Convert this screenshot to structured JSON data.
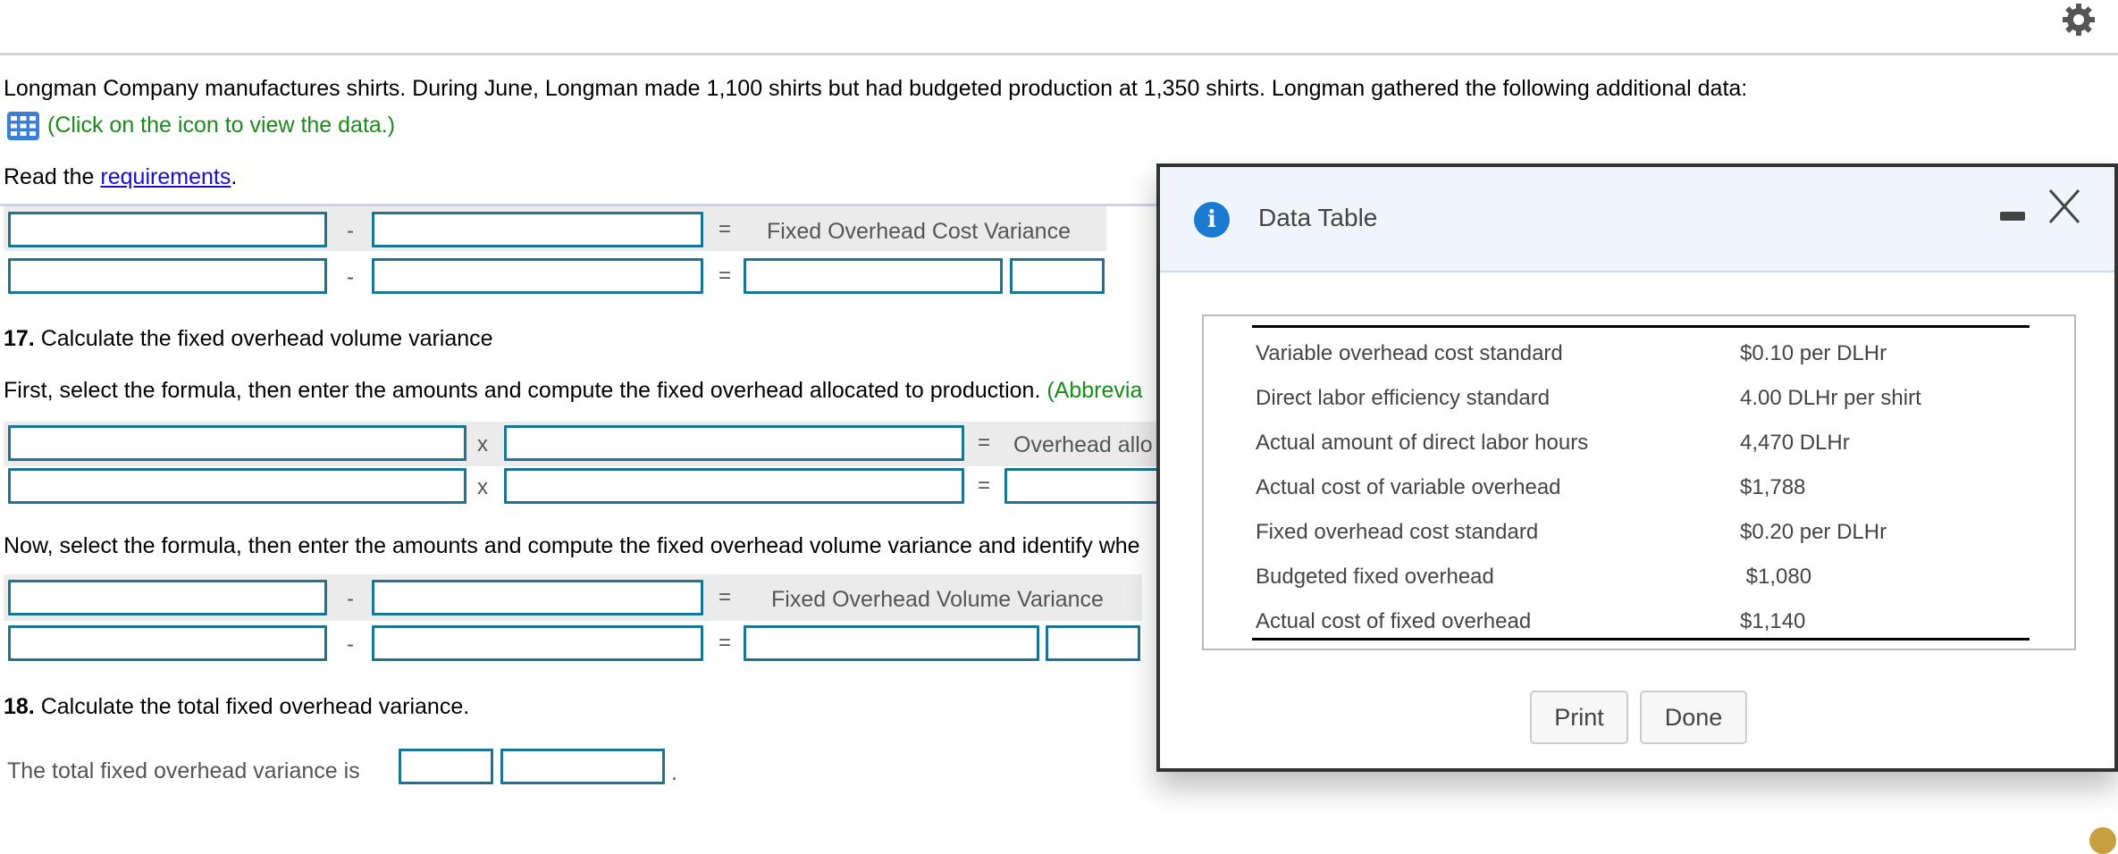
{
  "header": {
    "settings_icon": "gear-icon"
  },
  "intro": {
    "problem_text": "Longman Company manufactures shirts. During June, Longman made 1,100 shirts but had budgeted production at 1,350 shirts. Longman gathered the following additional data:",
    "data_icon": "table-grid-icon",
    "data_link_text": "(Click on the icon to view the data.)",
    "read_prefix": "Read the ",
    "requirements_link": "requirements",
    "read_suffix": "."
  },
  "section16": {
    "op1": "-",
    "eq": "=",
    "result_label": "Fixed Overhead Cost Variance",
    "row2_op1": "-",
    "row2_eq": "=",
    "inputs": {
      "formula_a": "",
      "formula_b": "",
      "amount_a": "",
      "amount_b": "",
      "result": "",
      "result_type": ""
    }
  },
  "section17": {
    "number": "17.",
    "heading": " Calculate the fixed overhead volume variance",
    "instruction1": "First, select the formula, then enter the amounts and compute the fixed overhead allocated to production. ",
    "instruction1_hint": "(Abbrevia",
    "alloc_op": "x",
    "alloc_eq": "=",
    "alloc_label": "Overhead allo",
    "instruction2": "Now, select the formula, then enter the amounts and compute the fixed overhead volume variance and identify whe",
    "vol_op": "-",
    "vol_eq": "=",
    "vol_label": "Fixed Overhead Volume Variance"
  },
  "section18": {
    "number": "18.",
    "heading": " Calculate the total fixed overhead variance.",
    "sentence": "The total fixed overhead variance is",
    "sentence_end": "."
  },
  "dialog": {
    "title": "Data Table",
    "info_icon": "i",
    "rows": [
      {
        "label": "Variable overhead cost standard",
        "value": "$0.10 per DLHr"
      },
      {
        "label": "Direct labor efficiency standard",
        "value": "4.00 DLHr per shirt"
      },
      {
        "label": "Actual amount of direct labor hours",
        "value": "4,470 DLHr"
      },
      {
        "label": "Actual cost of variable overhead",
        "value": "$1,788"
      },
      {
        "label": "Fixed overhead cost standard",
        "value": "$0.20 per DLHr"
      },
      {
        "label": "Budgeted fixed overhead",
        "value": " $1,080"
      },
      {
        "label": "Actual cost of fixed overhead",
        "value": "$1,140"
      }
    ],
    "print_label": "Print",
    "done_label": "Done"
  },
  "colors": {
    "input_border": "#1a7493",
    "hint_green": "#1a8a1a",
    "link_blue": "#1a0dcc",
    "band_grey": "#ebebeb",
    "info_blue": "#1a7bd0",
    "dialog_header_bg": "#f0f5fc"
  }
}
